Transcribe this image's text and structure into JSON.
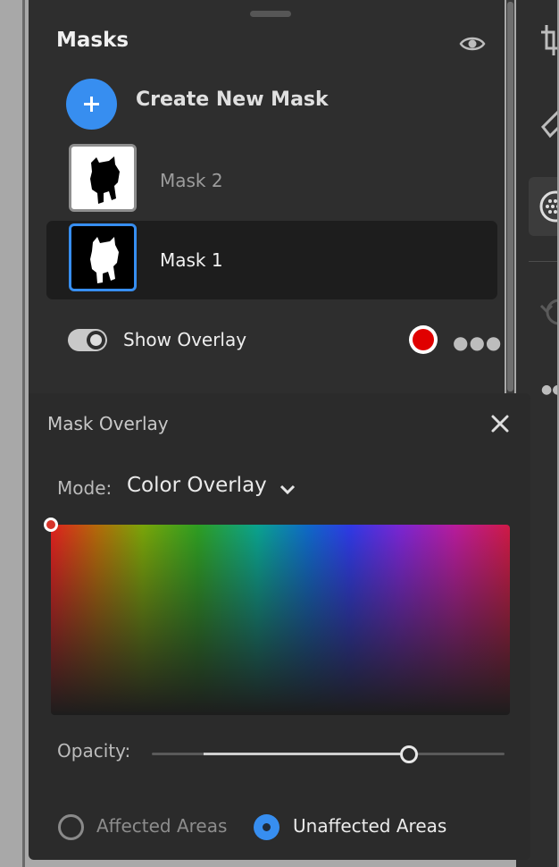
{
  "masks_panel": {
    "title": "Masks",
    "create_label": "Create New Mask",
    "masks": [
      {
        "label": "Mask 2",
        "selected": false
      },
      {
        "label": "Mask 1",
        "selected": true
      }
    ],
    "show_overlay_label": "Show Overlay",
    "show_overlay_on": true,
    "overlay_color": "#e00000"
  },
  "overlay_panel": {
    "title": "Mask Overlay",
    "mode_label": "Mode:",
    "mode_value": "Color Overlay",
    "opacity_label": "Opacity:",
    "opacity_percent": 73,
    "radio_affected": "Affected Areas",
    "radio_unaffected": "Unaffected Areas",
    "selected_area": "Unaffected Areas"
  },
  "theme": {
    "accent": "#378ef0",
    "panel_bg": "#2e2e2e"
  }
}
